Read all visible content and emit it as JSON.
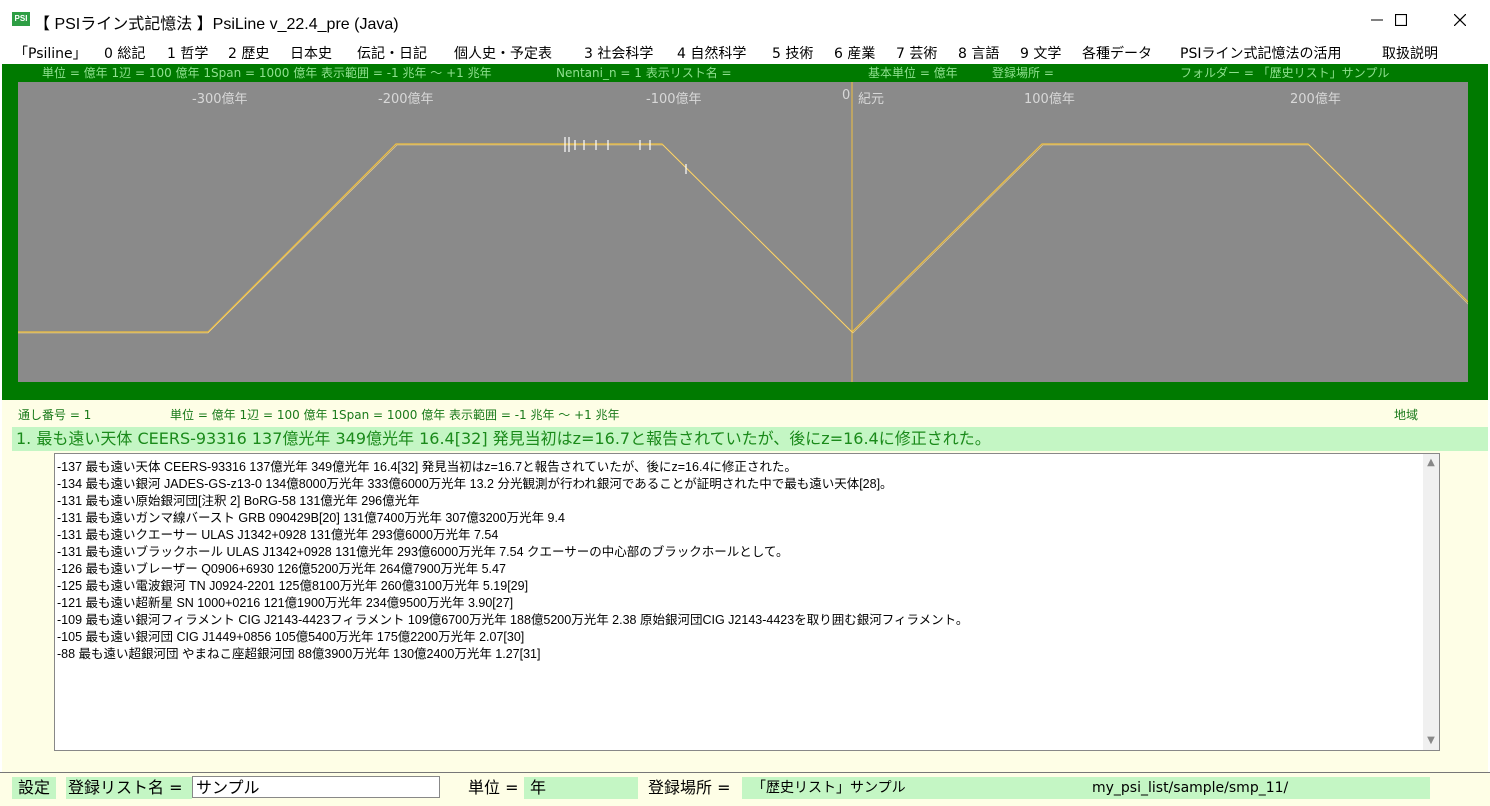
{
  "window": {
    "icon_text": "PSI",
    "title": "【 PSIライン式記憶法 】PsiLine v_22.4_pre (Java)"
  },
  "menu": [
    "「Psiline」",
    "0 総記",
    "1 哲学",
    "2 歴史",
    "日本史",
    "伝記・日記",
    "個人史・予定表",
    "3 社会科学",
    "4 自然科学",
    "5 技術",
    "6 産業",
    "7 芸術",
    "8 言語",
    "9 文学",
    "各種データ",
    "PSIライン式記憶法の活用",
    "取扱説明"
  ],
  "graph_header": {
    "unit": "単位 = 億年  1辺 = 100 億年  1Span = 1000 億年  表示範囲 = -1 兆年 〜 +1 兆年",
    "nentani": "Nentani_n = 1    表示リスト名 =",
    "base_unit": "基本単位 = 億年",
    "reg_place": "登録場所 =",
    "folder": "フォルダー = 「歴史リスト」サンプル"
  },
  "axis_labels": [
    "-300億年",
    "-200億年",
    "-100億年",
    "0",
    "紀元",
    "100億年",
    "200億年"
  ],
  "colors": {
    "frame_green": "#007a00",
    "canvas_gray": "#8a8a8a",
    "psi_line": "#f0c040",
    "headline_bg": "#c4f6c4"
  },
  "info_mid": {
    "serial": "通し番号 = 1",
    "unit": "単位 = 億年  1辺 = 100 億年  1Span = 1000 億年  表示範囲 = -1 兆年 〜 +1 兆年",
    "region": "地域"
  },
  "headline": "1. 最も遠い天体 CEERS-93316 137億光年 349億光年 16.4[32] 発見当初はz=16.7と報告されていたが、後にz=16.4に修正された。",
  "list": [
    "-137  最も遠い天体 CEERS-93316 137億光年 349億光年 16.4[32] 発見当初はz=16.7と報告されていたが、後にz=16.4に修正された。",
    "-134  最も遠い銀河 JADES-GS-z13-0 134億8000万光年 333億6000万光年 13.2 分光観測が行われ銀河であることが証明された中で最も遠い天体[28]。",
    "-131  最も遠い原始銀河団[注釈 2] BoRG-58 131億光年 296億光年",
    "-131  最も遠いガンマ線バースト GRB 090429B[20] 131億7400万光年 307億3200万光年 9.4",
    "-131  最も遠いクエーサー ULAS J1342+0928 131億光年 293億6000万光年 7.54",
    "-131  最も遠いブラックホール ULAS J1342+0928 131億光年 293億6000万光年 7.54 クエーサーの中心部のブラックホールとして。",
    "-126  最も遠いブレーザー Q0906+6930 126億5200万光年 264億7900万光年 5.47",
    "-125  最も遠い電波銀河 TN J0924-2201 125億8100万光年 260億3100万光年 5.19[29]",
    "-121  最も遠い超新星 SN 1000+0216 121億1900万光年 234億9500万光年 3.90[27]",
    "-109  最も遠い銀河フィラメント CIG J2143-4423フィラメント 109億6700万光年 188億5200万光年 2.38 原始銀河団CIG J2143-4423を取り囲む銀河フィラメント。",
    "-105  最も遠い銀河団 CIG J1449+0856 105億5400万光年 175億2200万光年 2.07[30]",
    "-88  最も遠い超銀河団 やまねこ座超銀河団 88億3900万光年 130億2400万光年 1.27[31]"
  ],
  "bottom": {
    "settings": "設定",
    "reg_list_label": "登録リスト名 =",
    "reg_list_value": "サンプル",
    "unit_label": "単位 =",
    "unit_value": "年",
    "place_label": "登録場所 =",
    "place_value": "「歴史リスト」サンプル",
    "path": "my_psi_list/sample/smp_11/"
  }
}
